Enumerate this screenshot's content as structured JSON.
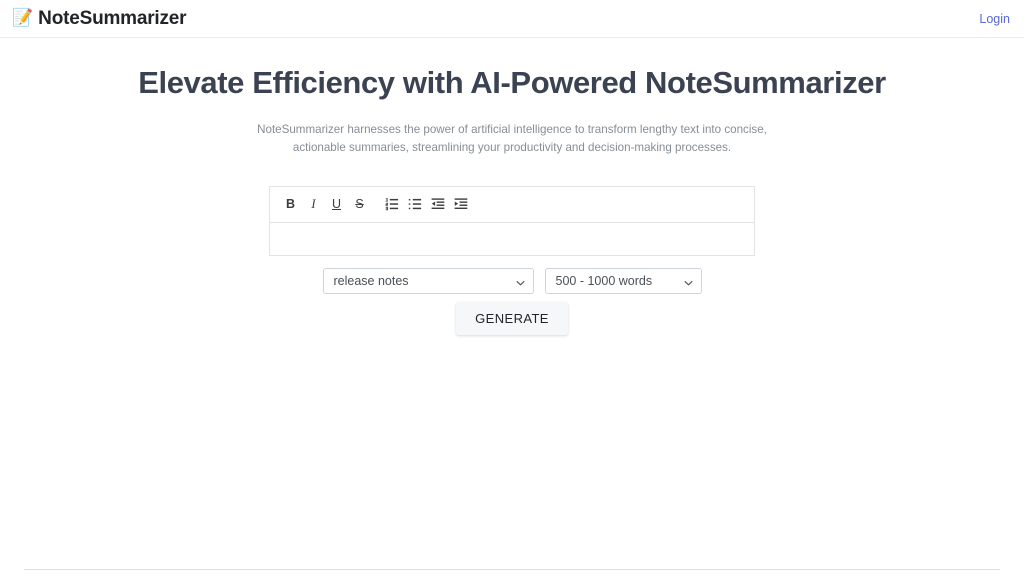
{
  "header": {
    "brand_icon": "memo-icon",
    "brand_name": "NoteSummarizer",
    "login_label": "Login",
    "login_color": "#5a67d8"
  },
  "hero": {
    "title": "Elevate Efficiency with AI-Powered NoteSummarizer",
    "subtitle": "NoteSummarizer harnesses the power of artificial intelligence to transform lengthy text into concise, actionable summaries, streamlining your productivity and decision-making processes."
  },
  "editor": {
    "toolbar": {
      "bold": "B",
      "italic": "I",
      "underline": "U",
      "strikethrough": "S",
      "ordered_list": "ordered-list-icon",
      "unordered_list": "unordered-list-icon",
      "outdent": "outdent-icon",
      "indent": "indent-icon"
    },
    "content": "",
    "placeholder": ""
  },
  "controls": {
    "summary_type": {
      "selected": "release notes",
      "options": [
        "release notes"
      ]
    },
    "summary_length": {
      "selected": "500 - 1000 words",
      "options": [
        "500 - 1000 words"
      ]
    },
    "generate_label": "GENERATE"
  }
}
